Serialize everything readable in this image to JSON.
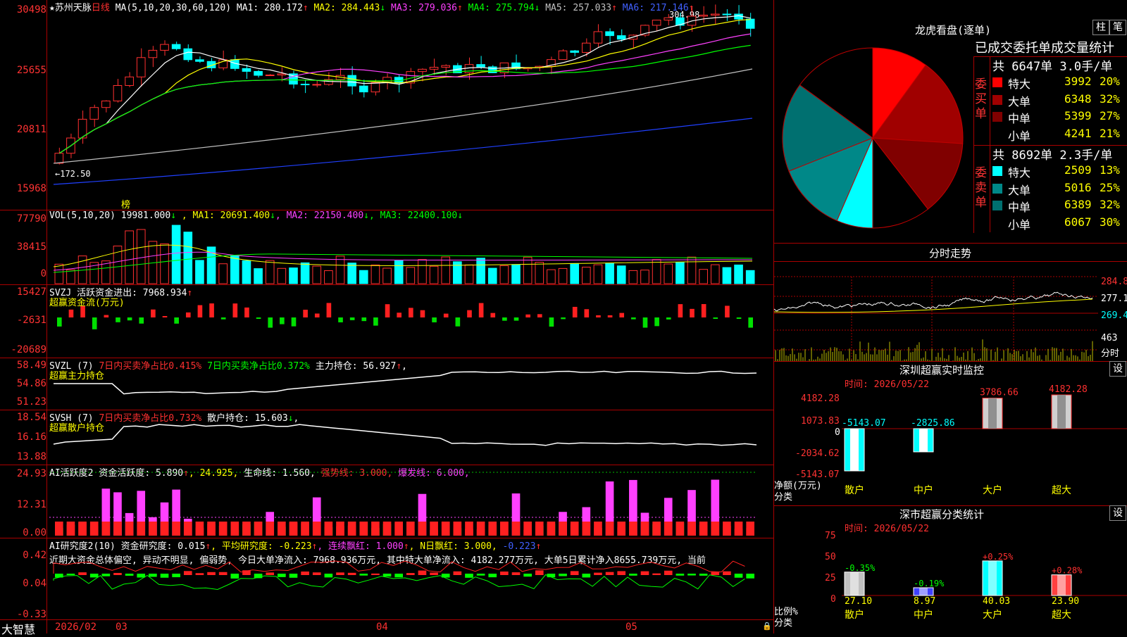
{
  "header": {
    "star": "★",
    "stock_name": "苏州天脉",
    "period": "日线",
    "ma_title": "MA(5,10,20,30,60,120)",
    "ma_items": [
      {
        "label": "MA1:",
        "value": "280.172",
        "arrow": "↑",
        "color": "#ffffff"
      },
      {
        "label": "MA2:",
        "value": "284.443",
        "arrow": "↓",
        "color": "#ffff00"
      },
      {
        "label": "MA3:",
        "value": "279.036",
        "arrow": "↑",
        "color": "#ff40ff"
      },
      {
        "label": "MA4:",
        "value": "275.794",
        "arrow": "↓",
        "color": "#00ff00"
      },
      {
        "label": "MA5:",
        "value": "257.033",
        "arrow": "↑",
        "color": "#c0c0c0"
      },
      {
        "label": "MA6:",
        "value": "217.146",
        "arrow": "↑",
        "color": "#4060ff"
      }
    ],
    "high_marker": "304.98",
    "low_marker": "←172.50",
    "bang_label": "榜"
  },
  "price_axis": [
    "30498",
    "25655",
    "20811",
    "15968"
  ],
  "vol": {
    "title": "VOL(5,10,20)",
    "value": "19981.000",
    "arrow": "↓",
    "items": [
      {
        "label": "MA1:",
        "value": "20691.400",
        "arrow": "↓",
        "color": "#ffff00"
      },
      {
        "label": "MA2:",
        "value": "22150.400",
        "arrow": "↓",
        "color": "#ff40ff"
      },
      {
        "label": "MA3:",
        "value": "22400.100",
        "arrow": "↓",
        "color": "#00ff00"
      }
    ],
    "axis": [
      "77790",
      "38415",
      "0"
    ]
  },
  "svzj": {
    "title": "SVZJ",
    "label": "活跃资金进出:",
    "value": "7968.934",
    "arrow": "↑",
    "subtitle": "超赢资金流(万元)",
    "axis": [
      "15427",
      "-2631",
      "-20689"
    ]
  },
  "svzl": {
    "title": "SVZL (7)",
    "t1": "7日内买卖净占比0.415%",
    "t2": "7日内买卖净占比0.372%",
    "t3": "主力持仓: 56.927",
    "arrow": "↑",
    "tail": ",",
    "subtitle": "超赢主力持仓",
    "axis": [
      "58.49",
      "54.86",
      "51.23"
    ]
  },
  "svsh": {
    "title": "SVSH (7)",
    "t1": "7日内买卖净占比0.732%",
    "t2": "散户持仓: 15.603",
    "arrow": "↓",
    "tail": ",",
    "subtitle": "超赢散户持仓",
    "axis": [
      "18.54",
      "16.16",
      "13.88"
    ]
  },
  "ai1": {
    "title": "AI活跃度2",
    "t1": "资金活跃度: 5.890",
    "a1": "↑",
    "t2": ", 24.925,",
    "t3": "生命线: 1.560,",
    "t4": "强势线: 3.000,",
    "t5": "爆发线: 6.000,",
    "axis": [
      "24.93",
      "12.31",
      "0.00"
    ]
  },
  "ai2": {
    "title": "AI研究度2(10)",
    "t1": "资金研究度: 0.015",
    "a1": "↑",
    "t2": ", 平均研究度: -0.223",
    "a2": "↑",
    "t3": ", 连续飘红: 1.000",
    "a3": "↑",
    "t4": ", N日飘红: 3.000,",
    "t5": " -0.223",
    "a5": "↑",
    "desc": "近期大资金总体偏空, 异动不明显, 偏弱势, 今日大单净流入: 7968.936万元, 其中特大单净流入: 4182.277万元, 大单5日累计净入8655.739万元, 当前",
    "axis": [
      "0.42",
      "0.04",
      "-0.33"
    ]
  },
  "bottom_axis": {
    "brand": "大智慧",
    "dates": [
      "2026/02",
      "03",
      "04",
      "05"
    ]
  },
  "lhb": {
    "title": "龙虎看盘(逐单)",
    "btn1": "柱",
    "btn2": "笔",
    "subtitle": "已成交委托单成交量统计",
    "buy_label": "委买单",
    "sell_label": "委卖单",
    "buy_header": "共 6647单 3.0手/单",
    "sell_header": "共 8692单 2.3手/单",
    "buy_rows": [
      {
        "name": "特大",
        "value": "3992",
        "pct": "20%",
        "color": "#ff0000"
      },
      {
        "name": "大单",
        "value": "6348",
        "pct": "32%",
        "color": "#a00000"
      },
      {
        "name": "中单",
        "value": "5399",
        "pct": "27%",
        "color": "#800000"
      },
      {
        "name": "小单",
        "value": "4241",
        "pct": "21%",
        "color": "#000000"
      }
    ],
    "sell_rows": [
      {
        "name": "特大",
        "value": "2509",
        "pct": "13%",
        "color": "#00ffff"
      },
      {
        "name": "大单",
        "value": "5016",
        "pct": "25%",
        "color": "#008888"
      },
      {
        "name": "中单",
        "value": "6389",
        "pct": "32%",
        "color": "#007070"
      },
      {
        "name": "小单",
        "value": "6067",
        "pct": "30%",
        "color": "#000000"
      }
    ]
  },
  "fenshi": {
    "title": "分时走势",
    "axis": [
      "284.8",
      "277.1",
      "269.4"
    ],
    "vol_label": "463",
    "vol_unit": "分时"
  },
  "szcy": {
    "title": "深圳超赢实时监控",
    "btn": "设",
    "time": "时间: 2026/05/22",
    "axis": [
      "4182.28",
      "1073.83",
      "0",
      "-2034.62",
      "-5143.07"
    ],
    "axis_label1": "净额(万元)",
    "axis_label2": "分类",
    "bars": [
      {
        "label": "散户",
        "value": "-5143.07"
      },
      {
        "label": "中户",
        "value": "-2825.86"
      },
      {
        "label": "大户",
        "value": "3786.66"
      },
      {
        "label": "超大",
        "value": "4182.28"
      }
    ]
  },
  "sscy": {
    "title": "深市超赢分类统计",
    "btn": "设",
    "time": "时间: 2026/05/22",
    "axis": [
      "75",
      "50",
      "25",
      "0"
    ],
    "axis_label1": "比例%",
    "axis_label2": "分类",
    "bars": [
      {
        "label": "散户",
        "value": "27.10",
        "chg": "-0.35%"
      },
      {
        "label": "中户",
        "value": "8.97",
        "chg": "-0.19%"
      },
      {
        "label": "大户",
        "value": "40.03",
        "chg": "+0.25%"
      },
      {
        "label": "超大",
        "value": "23.90",
        "chg": "+0.28%"
      }
    ]
  }
}
